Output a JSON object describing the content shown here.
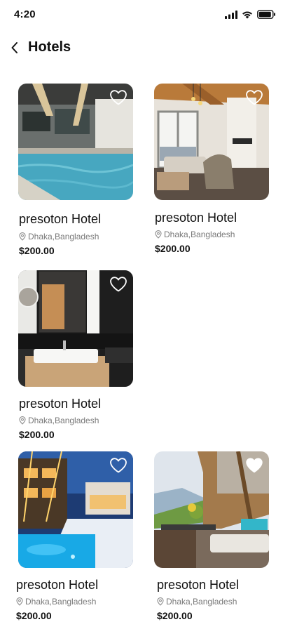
{
  "status": {
    "time": "4:20"
  },
  "header": {
    "title": "Hotels"
  },
  "hotels": [
    {
      "name": "presoton Hotel",
      "location": "Dhaka,Bangladesh",
      "price": "$200.00",
      "favorite": false,
      "scene": "pool-building"
    },
    {
      "name": "presoton Hotel",
      "location": "Dhaka,Bangladesh",
      "price": "$200.00",
      "favorite": false,
      "scene": "lounge-interior"
    },
    {
      "name": "presoton Hotel",
      "location": "Dhaka,Bangladesh",
      "price": "$200.00",
      "favorite": false,
      "scene": "bathroom-sink"
    },
    {
      "name": "presoton Hotel",
      "location": "Dhaka,Bangladesh",
      "price": "$200.00",
      "favorite": false,
      "scene": "night-pool"
    },
    {
      "name": "presoton Hotel",
      "location": "Dhaka,Bangladesh",
      "price": "$200.00",
      "favorite": true,
      "scene": "terrace-mountain"
    }
  ]
}
